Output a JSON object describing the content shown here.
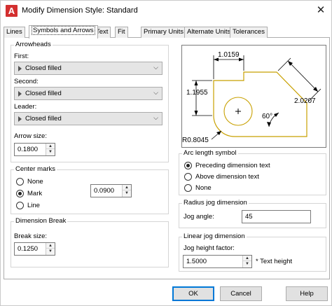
{
  "window": {
    "title": "Modify Dimension Style: Standard",
    "app_icon_letter": "A",
    "close_glyph": "✕"
  },
  "tabs": [
    {
      "label": "Lines"
    },
    {
      "label": "Symbols and Arrows"
    },
    {
      "label": "Text"
    },
    {
      "label": "Fit"
    },
    {
      "label": "Primary Units"
    },
    {
      "label": "Alternate Units"
    },
    {
      "label": "Tolerances"
    }
  ],
  "arrowheads": {
    "title": "Arrowheads",
    "first_label": "First:",
    "first_value": "Closed filled",
    "second_label": "Second:",
    "second_value": "Closed filled",
    "leader_label": "Leader:",
    "leader_value": "Closed filled",
    "arrow_size_label": "Arrow size:",
    "arrow_size_value": "0.1800"
  },
  "center_marks": {
    "title": "Center marks",
    "options": [
      "None",
      "Mark",
      "Line"
    ],
    "selected": "Mark",
    "size_value": "0.0900"
  },
  "dimension_break": {
    "title": "Dimension Break",
    "break_size_label": "Break size:",
    "break_size_value": "0.1250"
  },
  "preview": {
    "dim_top": "1.0159",
    "dim_left": "1.1955",
    "dim_right": "2.0207",
    "dim_angle": "60°",
    "dim_radius": "R0.8045"
  },
  "arc_length": {
    "title": "Arc length symbol",
    "options": [
      "Preceding dimension text",
      "Above dimension text",
      "None"
    ],
    "selected": "Preceding dimension text"
  },
  "radius_jog": {
    "title": "Radius jog dimension",
    "jog_angle_label": "Jog angle:",
    "jog_angle_value": "45"
  },
  "linear_jog": {
    "title": "Linear jog dimension",
    "height_factor_label": "Jog height factor:",
    "height_factor_value": "1.5000",
    "suffix": "* Text height"
  },
  "buttons": {
    "ok": "OK",
    "cancel": "Cancel",
    "help": "Help"
  },
  "colors": {
    "accent": "#0078d7",
    "preview_shape": "#c8a000",
    "app_icon": "#d32f2f"
  }
}
